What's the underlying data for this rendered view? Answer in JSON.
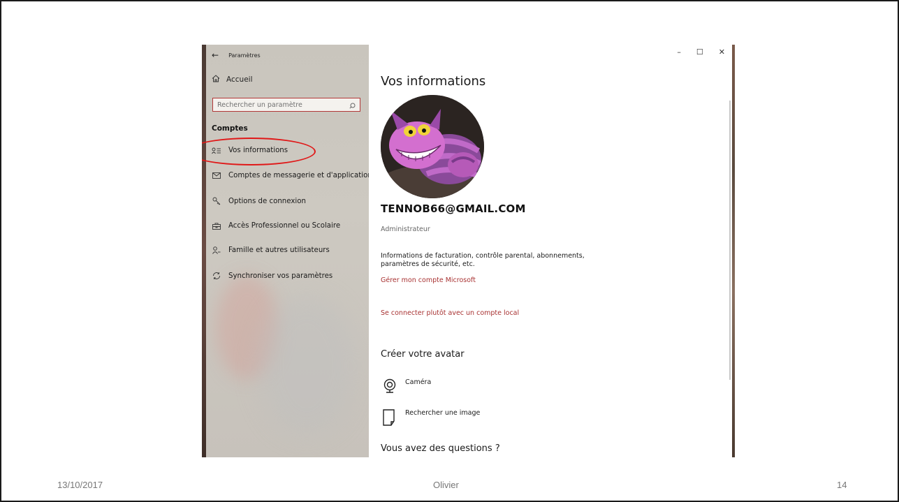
{
  "window": {
    "title": "Paramètres",
    "controls": {
      "minimize": "–",
      "maximize": "☐",
      "close": "✕"
    }
  },
  "sidebar": {
    "home_label": "Accueil",
    "search_placeholder": "Rechercher un paramètre",
    "section_title": "Comptes",
    "items": [
      {
        "label": "Vos informations",
        "icon": "user-info-icon",
        "selected": true
      },
      {
        "label": "Comptes de messagerie et d'application",
        "icon": "mail-icon"
      },
      {
        "label": "Options de connexion",
        "icon": "key-icon"
      },
      {
        "label": "Accès Professionnel ou Scolaire",
        "icon": "briefcase-icon"
      },
      {
        "label": "Famille et autres utilisateurs",
        "icon": "person-add-icon"
      },
      {
        "label": "Synchroniser vos paramètres",
        "icon": "sync-icon"
      }
    ]
  },
  "main": {
    "title": "Vos informations",
    "email": "TENNOB66@GMAIL.COM",
    "role": "Administrateur",
    "info_text": "Informations de facturation, contrôle parental, abonnements, paramètres de sécurité, etc.",
    "manage_link": "Gérer mon compte Microsoft",
    "local_link": "Se connecter plutôt avec un compte local",
    "avatar_section_title": "Créer votre avatar",
    "camera_label": "Caméra",
    "browse_label": "Rechercher une image",
    "questions_title": "Vous avez des questions ?"
  },
  "footer": {
    "date": "13/10/2017",
    "author": "Olivier",
    "page": "14"
  },
  "colors": {
    "accent_red": "#b23838",
    "highlight": "#e01818",
    "link": "#a83232"
  }
}
